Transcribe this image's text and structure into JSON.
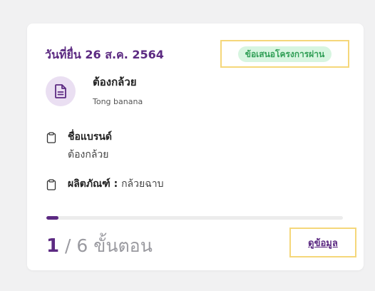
{
  "card": {
    "date": "วันที่ยื่น 26 ส.ค. 2564",
    "status": "ข้อเสนอโครงการผ่าน",
    "project_name": "ต้องกล้วย",
    "project_sub": "Tong banana",
    "brand_label": "ชื่อแบรนด์",
    "brand_value": "ต้องกล้วย",
    "product_label": "ผลิตภัณฑ์",
    "product_colon": " : ",
    "product_value": "กล้วยฉาบ",
    "steps_current": "1",
    "steps_rest": " / 6 ขั้นตอน",
    "progress_fraction": 0.04,
    "view_label": "ดูข้อมูล"
  },
  "icons": {
    "avatar": "document-icon",
    "brand": "clipboard-icon",
    "product": "clipboard-icon"
  },
  "colors": {
    "accent": "#5c2a82",
    "status_bg": "#d7f5e0",
    "status_text": "#2f9e55",
    "highlight_border": "#f5d77a"
  }
}
